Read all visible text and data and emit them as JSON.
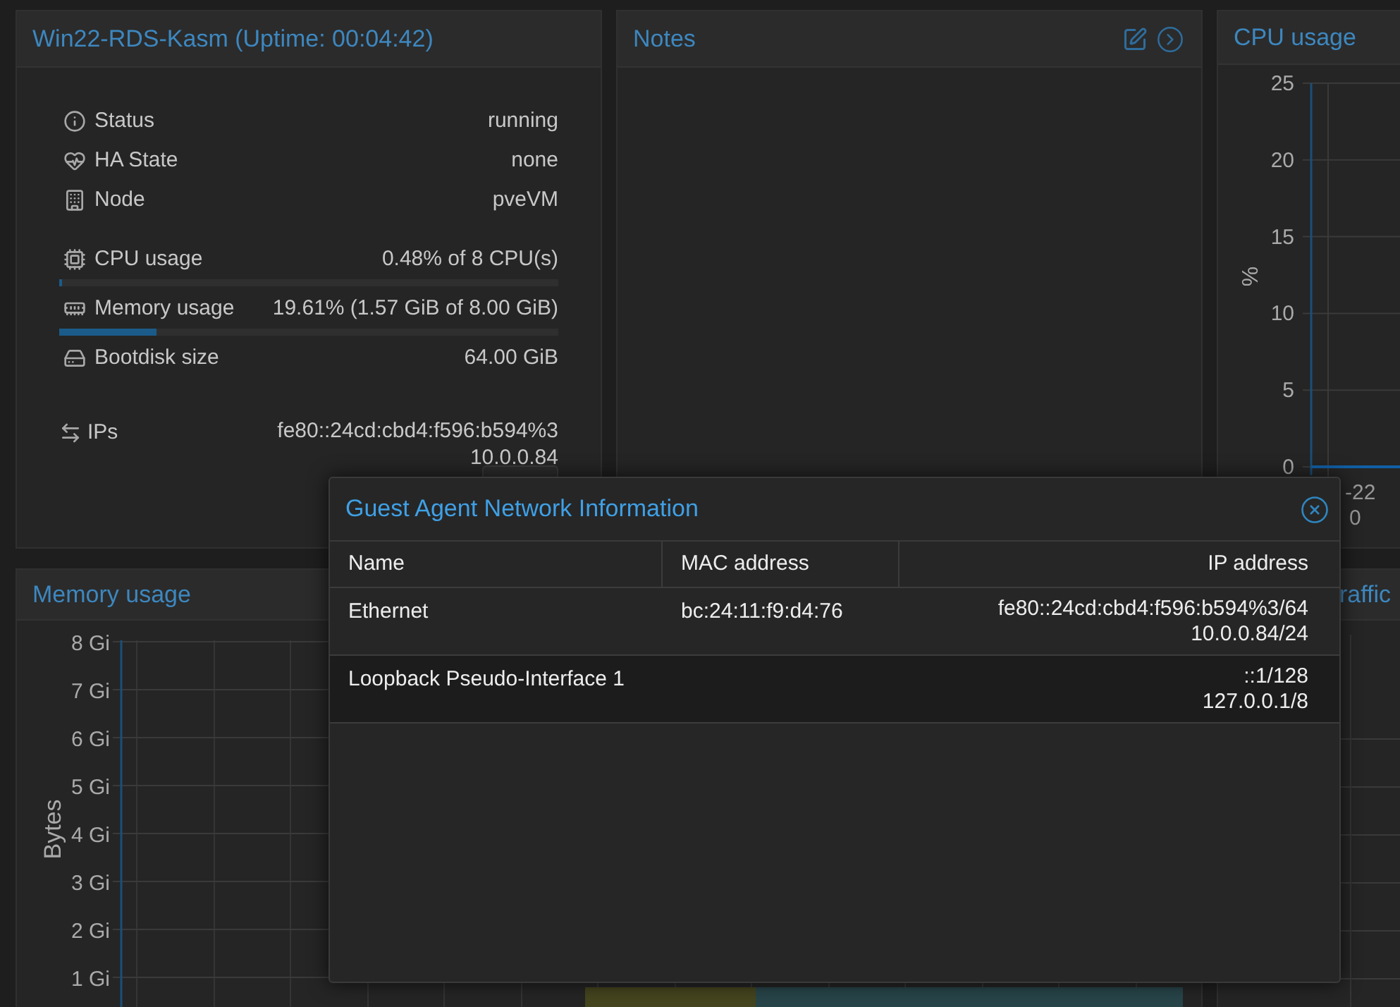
{
  "summary_panel": {
    "title": "Win22-RDS-Kasm (Uptime: 00:04:42)",
    "rows": [
      {
        "kind": "text",
        "label": "Status",
        "value": "running"
      },
      {
        "kind": "text",
        "label": "HA State",
        "value": "none"
      },
      {
        "kind": "text",
        "label": "Node",
        "value": "pveVM"
      },
      {
        "kind": "meter",
        "label": "CPU usage",
        "value": "0.48% of 8 CPU(s)",
        "level": 0.0048
      },
      {
        "kind": "meter",
        "label": "Memory usage",
        "value": "19.61% (1.57 GiB of 8.00 GiB)",
        "level": 0.1961
      },
      {
        "kind": "text",
        "label": "Bootdisk size",
        "value": "64.00 GiB"
      },
      {
        "kind": "lines",
        "label": "IPs",
        "lines": [
          "fe80::24cd:cbd4:f596:b594%3",
          "10.0.0.84"
        ]
      }
    ]
  },
  "notes_panel": {
    "title": "Notes"
  },
  "cpu_panel": {
    "title": "CPU usage",
    "x_label_lines": [
      "-22",
      "0"
    ],
    "y_axis_title": "%",
    "y_ticks": [
      "25",
      "20",
      "15",
      "10",
      "5",
      "0"
    ]
  },
  "memory_panel": {
    "title": "Memory usage",
    "y_axis_title": "Bytes",
    "y_ticks": [
      "8 Gi",
      "7 Gi",
      "6 Gi",
      "5 Gi",
      "4 Gi",
      "3 Gi",
      "2 Gi",
      "1 Gi"
    ]
  },
  "traffic_panel": {
    "title": "raffic"
  },
  "dialog": {
    "title": "Guest Agent Network Information",
    "table": {
      "columns": [
        "Name",
        "MAC address",
        "IP address"
      ],
      "rows": [
        {
          "name": "Ethernet",
          "mac": "bc:24:11:f9:d4:76",
          "ips": [
            "fe80::24cd:cbd4:f596:b594%3/64",
            "10.0.0.84/24"
          ]
        },
        {
          "name": "Loopback Pseudo-Interface 1",
          "ips": [
            "::1/128",
            "127.0.0.1/8"
          ]
        }
      ]
    }
  }
}
